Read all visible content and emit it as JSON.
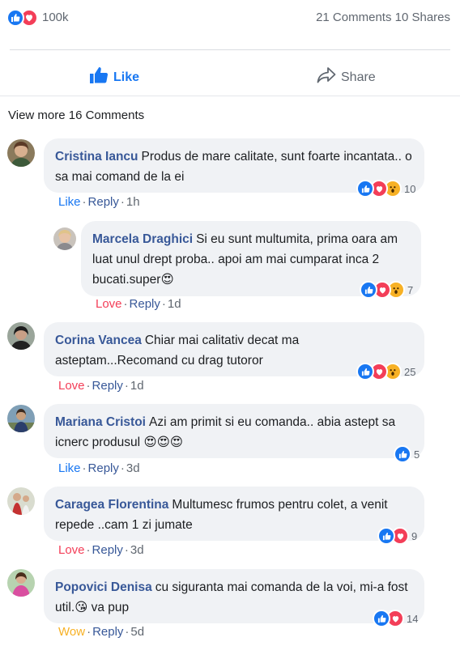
{
  "post_stats": {
    "reactions_count": "100k",
    "comments_shares": "21 Comments 10 Shares"
  },
  "actions": {
    "like_label": "Like",
    "share_label": "Share"
  },
  "view_more": "View more 16 Comments",
  "comments": [
    {
      "author": "Cristina Iancu",
      "text": "Produs de mare calitate, sunt foarte incantata.. o sa mai comand de la ei",
      "reaction_label": "Like",
      "reaction_color": "#1877f2",
      "reply_label": "Reply",
      "time": "1h",
      "reaction_count": "10",
      "reaction_icons": [
        "like-icon",
        "love-icon",
        "wow-icon"
      ]
    },
    {
      "author": "Marcela Draghici",
      "text": "Si eu sunt multumita, prima oara am luat unul drept proba.. apoi am mai cumparat inca 2 bucati.super😍",
      "reaction_label": "Love",
      "reaction_color": "#f33e58",
      "reply_label": "Reply",
      "time": "1d",
      "reaction_count": "7",
      "reaction_icons": [
        "like-icon",
        "love-icon",
        "wow-icon"
      ]
    },
    {
      "author": "Corina Vancea",
      "text": "Chiar mai calitativ decat ma asteptam...Recomand cu drag tutoror",
      "reaction_label": "Love",
      "reaction_color": "#f33e58",
      "reply_label": "Reply",
      "time": "1d",
      "reaction_count": "25",
      "reaction_icons": [
        "like-icon",
        "love-icon",
        "wow-icon"
      ]
    },
    {
      "author": "Mariana Cristoi",
      "text": "Azi am primit si eu comanda.. abia astept sa icnerc produsul 😍😍😍",
      "reaction_label": "Like",
      "reaction_color": "#1877f2",
      "reply_label": "Reply",
      "time": "3d",
      "reaction_count": "5",
      "reaction_icons": [
        "like-icon"
      ]
    },
    {
      "author": "Caragea Florentina",
      "text": "Multumesc frumos pentru colet, a venit repede ..cam 1 zi jumate",
      "reaction_label": "Love",
      "reaction_color": "#f33e58",
      "reply_label": "Reply",
      "time": "3d",
      "reaction_count": "9",
      "reaction_icons": [
        "like-icon",
        "love-icon"
      ]
    },
    {
      "author": "Popovici Denisa",
      "text": "cu siguranta mai comanda de la voi, mi-a fost util.😘 va pup",
      "reaction_label": "Wow",
      "reaction_color": "#f7b125",
      "reply_label": "Reply",
      "time": "5d",
      "reaction_count": "14",
      "reaction_icons": [
        "like-icon",
        "love-icon"
      ]
    }
  ]
}
